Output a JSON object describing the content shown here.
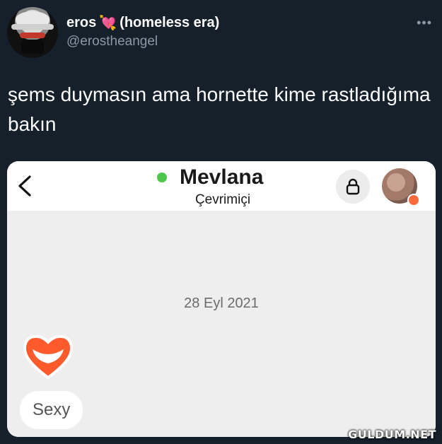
{
  "tweet": {
    "display_name": "eros",
    "name_emoji": "💘",
    "name_suffix": "(homeless era)",
    "handle": "@erostheangel",
    "more_icon": "more-horizontal-icon",
    "text": "şems duymasın ama hornette kime rastladığıma bakın"
  },
  "chat": {
    "contact_name": "Mevlana",
    "status": "Çevrimiçi",
    "status_color": "#4cc74a",
    "date": "28 Eyl 2021",
    "sticker": "heart-smile-sticker",
    "message": "Sexy"
  },
  "watermark": "GULDUM.NET"
}
